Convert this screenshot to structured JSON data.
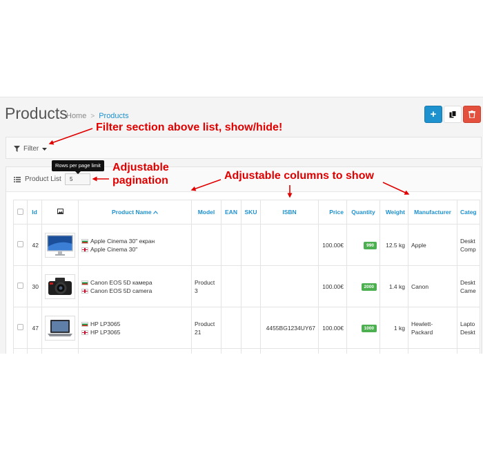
{
  "page": {
    "title": "Products"
  },
  "breadcrumb": {
    "home": "Home",
    "separator": ">",
    "current": "Products"
  },
  "actions": {
    "add": "+",
    "copy_icon": "copy-icon",
    "delete_icon": "trash-icon"
  },
  "filter": {
    "label": "Filter"
  },
  "list": {
    "label": "Product List",
    "rows_value": "5",
    "tooltip": "Rows per page limit"
  },
  "table": {
    "headers": {
      "id": "Id",
      "product_name": "Product Name",
      "model": "Model",
      "ean": "EAN",
      "sku": "SKU",
      "isbn": "ISBN",
      "price": "Price",
      "quantity": "Quantity",
      "weight": "Weight",
      "manufacturer": "Manufacturer",
      "category": "Categ"
    },
    "rows": [
      {
        "id": "42",
        "image": "monitor",
        "name_bg": "Apple Cinema 30\" екран",
        "name_en": "Apple Cinema 30\"",
        "model": "",
        "ean": "",
        "sku": "",
        "isbn": "",
        "price": "100.00€",
        "quantity": "990",
        "weight": "12.5 kg",
        "manufacturer": "Apple",
        "category_1": "Deskt",
        "category_2": "Comp"
      },
      {
        "id": "30",
        "image": "camera",
        "name_bg": "Canon EOS 5D камера",
        "name_en": "Canon EOS 5D camera",
        "model": "Product 3",
        "ean": "",
        "sku": "",
        "isbn": "",
        "price": "100.00€",
        "quantity": "2000",
        "weight": "1.4 kg",
        "manufacturer": "Canon",
        "category_1": "Deskt",
        "category_2": "Came"
      },
      {
        "id": "47",
        "image": "laptop",
        "name_bg": "HP LP3065",
        "name_en": "HP LP3065",
        "model": "Product 21",
        "ean": "",
        "sku": "",
        "isbn": "4455BG1234UY67",
        "price": "100.00€",
        "quantity": "1000",
        "weight": "1 kg",
        "manufacturer": "Hewlett-Packard",
        "category_1": "Lapto",
        "category_2": "Deskt"
      }
    ]
  },
  "annotations": {
    "filter": "Filter section above list, show/hide!",
    "pagination_1": "Adjustable",
    "pagination_2": "pagination",
    "columns": "Adjustable columns to show"
  },
  "colors": {
    "accent": "#1e91cf",
    "danger": "#e3503e",
    "annotation": "#e00000",
    "quantity_badge": "#4caf50"
  }
}
